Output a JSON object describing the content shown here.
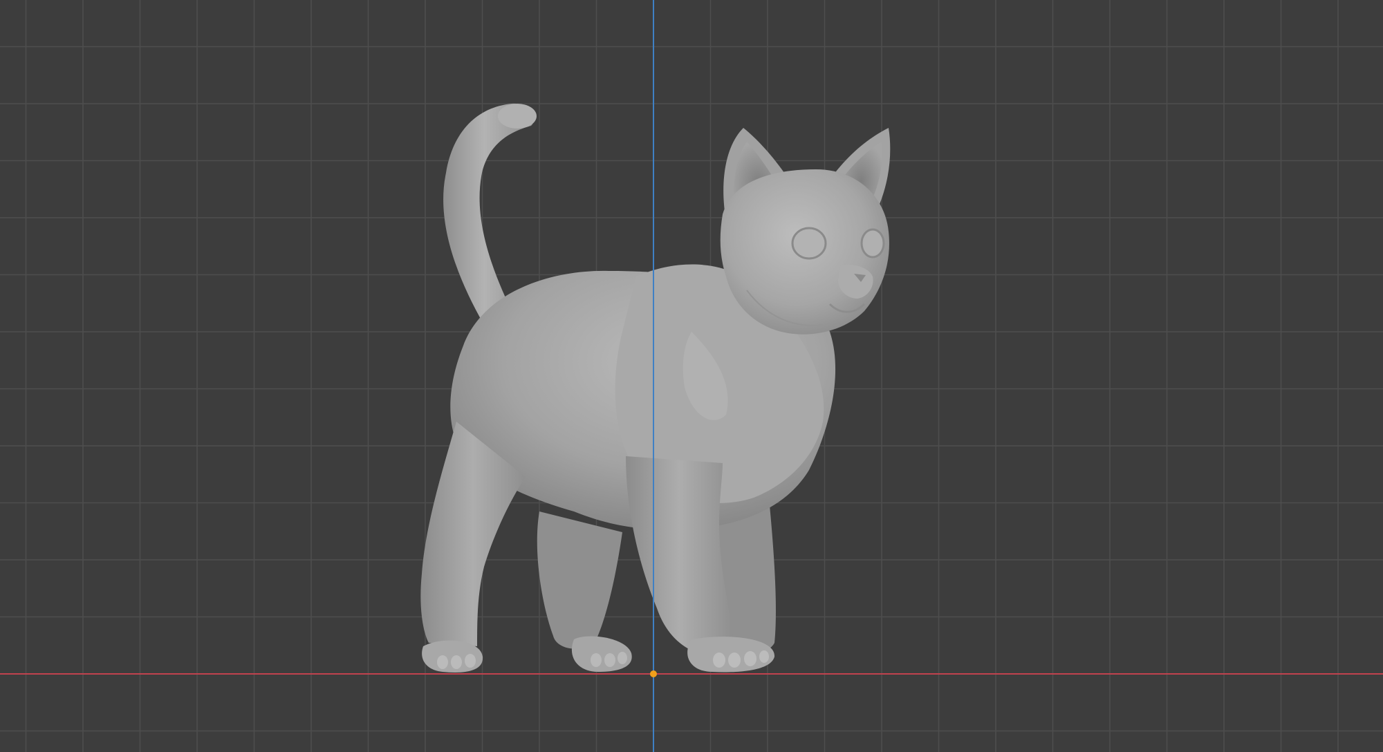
{
  "viewport": {
    "view": "orthographic-side",
    "background_color": "#3d3d3d",
    "grid": {
      "visible": true,
      "line_color": "#4e4e4e"
    },
    "axes": {
      "x_axis_color": "#c2424e",
      "z_axis_color": "#3f80c4"
    },
    "origin": {
      "color": "#f1a01b"
    },
    "object": {
      "type": "sculpted-mesh",
      "subject": "standing cat",
      "material_color": "#a4a4a4",
      "shading": "solid-matcap-gray"
    }
  }
}
